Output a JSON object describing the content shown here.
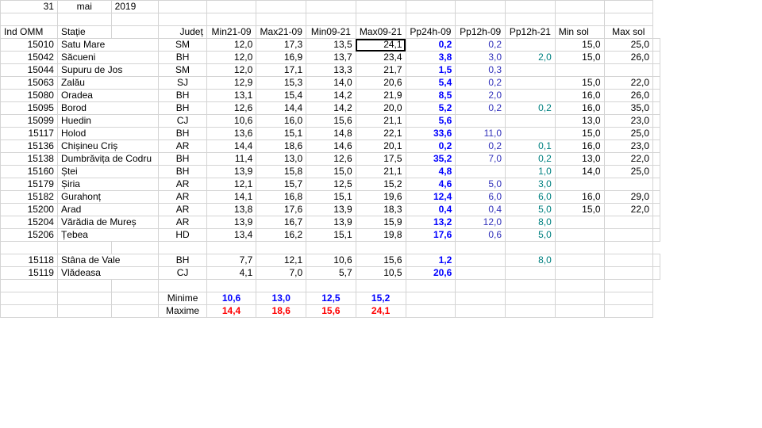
{
  "colors": {
    "blue": "#0000ff",
    "teal": "#008080",
    "red": "#ff0000",
    "purple": "#3333bb",
    "black": "#000000"
  },
  "sheet": {
    "date_row": {
      "day": "31",
      "month": "mai",
      "year": "2019"
    },
    "headers": [
      "Ind OMM",
      "Stație",
      "Județ",
      "Min21-09",
      "Max21-09",
      "Min09-21",
      "Max09-21",
      "Pp24h-09",
      "Pp12h-09",
      "Pp12h-21",
      "Min sol",
      "Max sol"
    ],
    "stations_a": [
      [
        "15010",
        "Satu Mare",
        "SM",
        "12,0",
        "17,3",
        "13,5",
        "24,1",
        "0,2",
        "0,2",
        "",
        "15,0",
        "25,0"
      ],
      [
        "15042",
        "Săcueni",
        "BH",
        "12,0",
        "16,9",
        "13,7",
        "23,4",
        "3,8",
        "3,0",
        "2,0",
        "15,0",
        "26,0"
      ],
      [
        "15044",
        "Supuru de Jos",
        "SM",
        "12,0",
        "17,1",
        "13,3",
        "21,7",
        "1,5",
        "0,3",
        "",
        "",
        ""
      ],
      [
        "15063",
        "Zalău",
        "SJ",
        "12,9",
        "15,3",
        "14,0",
        "20,6",
        "5,4",
        "0,2",
        "",
        "15,0",
        "22,0"
      ],
      [
        "15080",
        "Oradea",
        "BH",
        "13,1",
        "15,4",
        "14,2",
        "21,9",
        "8,5",
        "2,0",
        "",
        "16,0",
        "26,0"
      ],
      [
        "15095",
        "Borod",
        "BH",
        "12,6",
        "14,4",
        "14,2",
        "20,0",
        "5,2",
        "0,2",
        "0,2",
        "16,0",
        "35,0"
      ],
      [
        "15099",
        "Huedin",
        "CJ",
        "10,6",
        "16,0",
        "15,6",
        "21,1",
        "5,6",
        "",
        "",
        "13,0",
        "23,0"
      ],
      [
        "15117",
        "Holod",
        "BH",
        "13,6",
        "15,1",
        "14,8",
        "22,1",
        "33,6",
        "11,0",
        "",
        "15,0",
        "25,0"
      ],
      [
        "15136",
        "Chișineu    Criș",
        "AR",
        "14,4",
        "18,6",
        "14,6",
        "20,1",
        "0,2",
        "0,2",
        "0,1",
        "16,0",
        "23,0"
      ],
      [
        "15138",
        "Dumbrăvița  de Codru",
        "BH",
        "11,4",
        "13,0",
        "12,6",
        "17,5",
        "35,2",
        "7,0",
        "0,2",
        "13,0",
        "22,0"
      ],
      [
        "15160",
        "Ștei",
        "BH",
        "13,9",
        "15,8",
        "15,0",
        "21,1",
        "4,8",
        "",
        "1,0",
        "14,0",
        "25,0"
      ],
      [
        "15179",
        "Șiria",
        "AR",
        "12,1",
        "15,7",
        "12,5",
        "15,2",
        "4,6",
        "5,0",
        "3,0",
        "",
        ""
      ],
      [
        "15182",
        "Gurahonț",
        "AR",
        "14,1",
        "16,8",
        "15,1",
        "19,6",
        "12,4",
        "6,0",
        "6,0",
        "16,0",
        "29,0"
      ],
      [
        "15200",
        "Arad",
        "AR",
        "13,8",
        "17,6",
        "13,9",
        "18,3",
        "0,4",
        "0,4",
        "5,0",
        "15,0",
        "22,0"
      ],
      [
        "15204",
        "Vărădia de Mureș",
        "AR",
        "13,9",
        "16,7",
        "13,9",
        "15,9",
        "13,2",
        "12,0",
        "8,0",
        "",
        ""
      ],
      [
        "15206",
        "Țebea",
        "HD",
        "13,4",
        "16,2",
        "15,1",
        "19,8",
        "17,6",
        "0,6",
        "5,0",
        "",
        ""
      ]
    ],
    "stations_b": [
      [
        "15118",
        "Stâna de Vale",
        "BH",
        "7,7",
        "12,1",
        "10,6",
        "15,6",
        "1,2",
        "",
        "8,0",
        "",
        ""
      ],
      [
        "15119",
        "Vlădeasa",
        "CJ",
        "4,1",
        "7,0",
        "5,7",
        "10,5",
        "20,6",
        "",
        "",
        "",
        ""
      ]
    ],
    "minime": {
      "label": "Minime",
      "values": [
        "10,6",
        "13,0",
        "12,5",
        "15,2"
      ]
    },
    "maxime": {
      "label": "Maxime",
      "values": [
        "14,4",
        "18,6",
        "15,6",
        "24,1"
      ]
    }
  }
}
